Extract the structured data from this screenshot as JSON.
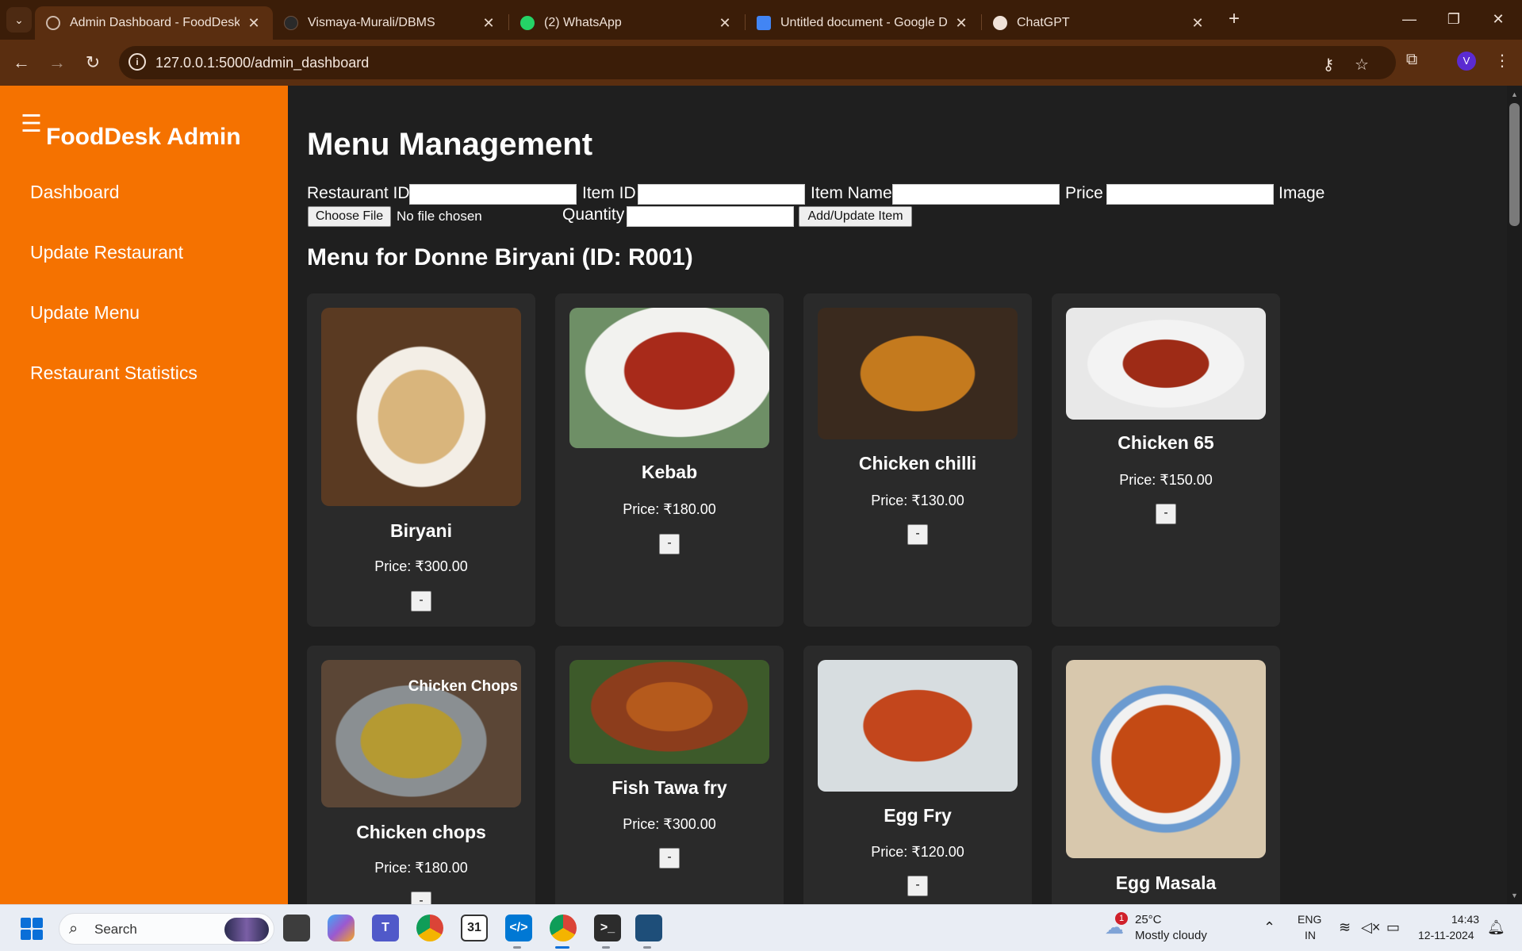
{
  "browser": {
    "tabs": [
      {
        "title": "Admin Dashboard - FoodDesk",
        "active": true,
        "icon": "globe-icon"
      },
      {
        "title": "Vismaya-Murali/DBMS",
        "active": false,
        "icon": "github-icon"
      },
      {
        "title": "(2) WhatsApp",
        "active": false,
        "icon": "whatsapp-icon"
      },
      {
        "title": "Untitled document - Google Do",
        "active": false,
        "icon": "google-docs-icon"
      },
      {
        "title": "ChatGPT",
        "active": false,
        "icon": "chatgpt-icon"
      }
    ],
    "url": "127.0.0.1:5000/admin_dashboard",
    "profile_initial": "V",
    "colors": {
      "chrome_dark": "#3b1d08",
      "chrome_mid": "#5a2e10"
    }
  },
  "sidebar": {
    "brand": "FoodDesk Admin",
    "menu_icon": "hamburger-icon",
    "items": [
      {
        "label": "Dashboard"
      },
      {
        "label": "Update Restaurant"
      },
      {
        "label": "Update Menu"
      },
      {
        "label": "Restaurant Statistics"
      }
    ],
    "accent_color": "#f57200"
  },
  "page": {
    "title": "Menu Management",
    "form": {
      "restaurant_id_label": "Restaurant ID",
      "item_id_label": "Item ID",
      "item_name_label": "Item Name",
      "price_label": "Price",
      "image_label": "Image",
      "choose_file_label": "Choose File",
      "file_status": "No file chosen",
      "quantity_label": "Quantity",
      "submit_label": "Add/Update Item",
      "restaurant_id_value": "",
      "item_id_value": "",
      "item_name_value": "",
      "price_value": "",
      "quantity_value": ""
    },
    "menu_heading": "Menu for Donne Biryani (ID: R001)",
    "items": [
      {
        "name": "Biryani",
        "price": "Price: ₹300.00",
        "remove": "-"
      },
      {
        "name": "Kebab",
        "price": "Price: ₹180.00",
        "remove": "-"
      },
      {
        "name": "Chicken chilli",
        "price": "Price: ₹130.00",
        "remove": "-"
      },
      {
        "name": "Chicken 65",
        "price": "Price: ₹150.00",
        "remove": "-"
      },
      {
        "name": "Chicken chops",
        "price": "Price: ₹180.00",
        "remove": "-",
        "image_caption": "Chicken Chops"
      },
      {
        "name": "Fish Tawa fry",
        "price": "Price: ₹300.00",
        "remove": "-"
      },
      {
        "name": "Egg Fry",
        "price": "Price: ₹120.00",
        "remove": "-"
      },
      {
        "name": "Egg Masala",
        "price": "",
        "remove": ""
      }
    ]
  },
  "taskbar": {
    "search_placeholder": "Search",
    "weather_temp": "25°C",
    "weather_desc": "Mostly cloudy",
    "weather_badge": "1",
    "language_top": "ENG",
    "language_bottom": "IN",
    "time": "14:43",
    "date": "12-11-2024"
  }
}
